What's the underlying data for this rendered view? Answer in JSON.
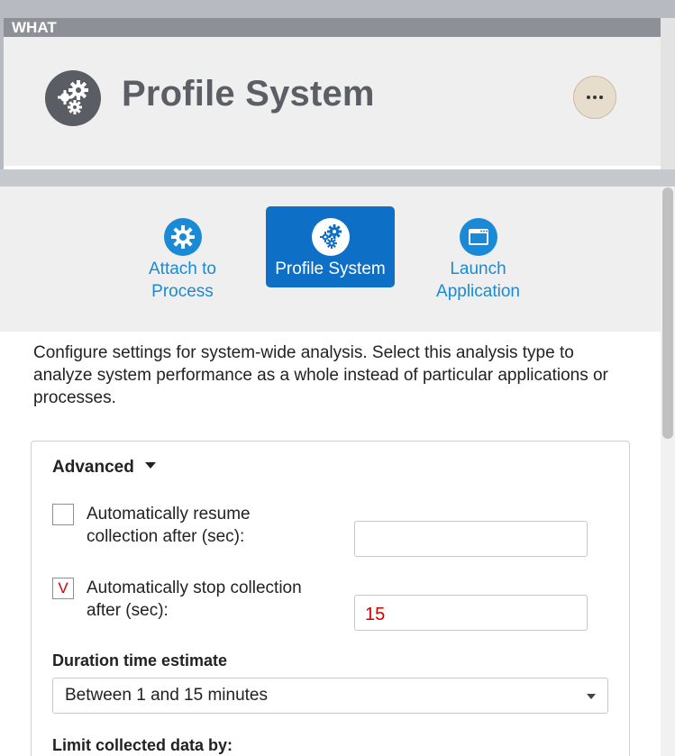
{
  "header": {
    "section_label": "WHAT",
    "title": "Profile System",
    "title_icon": "gears-icon",
    "more_icon": "more-horizontal-icon"
  },
  "analysis_types": [
    {
      "label_line1": "Attach to",
      "label_line2": "Process",
      "icon": "gear-icon",
      "selected": false
    },
    {
      "label_line1": "Profile System",
      "label_line2": "",
      "icon": "gears-icon",
      "selected": true
    },
    {
      "label_line1": "Launch",
      "label_line2": "Application",
      "icon": "window-icon",
      "selected": false
    }
  ],
  "description": "Configure settings for system-wide analysis. Select this analysis type to analyze system performance as a whole instead of particular applications or processes.",
  "advanced": {
    "header": "Advanced",
    "resume": {
      "label_line1": "Automatically resume",
      "label_line2": "collection after (sec):",
      "checked": false,
      "value": ""
    },
    "stop": {
      "label_line1": "Automatically stop collection",
      "label_line2": "after (sec):",
      "checked": true,
      "check_glyph": "V",
      "value": "15"
    },
    "duration_label": "Duration time estimate",
    "duration_value": "Between 1 and 15 minutes",
    "limit_label": "Limit collected data by:"
  },
  "colors": {
    "accent": "#0e6fc6",
    "link": "#1a8ad6",
    "check": "#d40000"
  }
}
